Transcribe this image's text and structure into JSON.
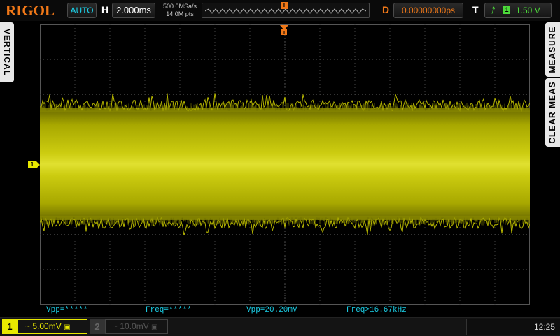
{
  "brand": "RIGOL",
  "top": {
    "mode": "AUTO",
    "horizontal_label": "H",
    "timebase": "2.000ms",
    "sample_rate": "500.0MSa/s",
    "memory_depth": "14.0M pts",
    "trigger_marker": "T",
    "delay_label": "D",
    "delay": "0.00000000ps",
    "trigger_label": "T",
    "trigger_source": "1",
    "trigger_level": "1.50 V"
  },
  "side": {
    "left_tab": "VERTICAL",
    "right_tab_1": "MEASURE",
    "right_tab_2": "CLEAR MEAS"
  },
  "channel1_marker": "1",
  "measurements": [
    {
      "text": "Vpp=*****"
    },
    {
      "text": "Freq=*****"
    },
    {
      "text": "Vpp=20.20mV"
    },
    {
      "text": "Freq>16.67kHz"
    }
  ],
  "bottom": {
    "ch1_number": "1",
    "ch1_scale": "~ 5.00mV",
    "ch2_number": "2",
    "ch2_scale": "~ 10.0mV",
    "time": "12:25"
  },
  "colors": {
    "brand": "#f07818",
    "ch1": "#e8e800",
    "accent_cyan": "#1bd0e8",
    "trigger_green": "#4cd93a"
  }
}
